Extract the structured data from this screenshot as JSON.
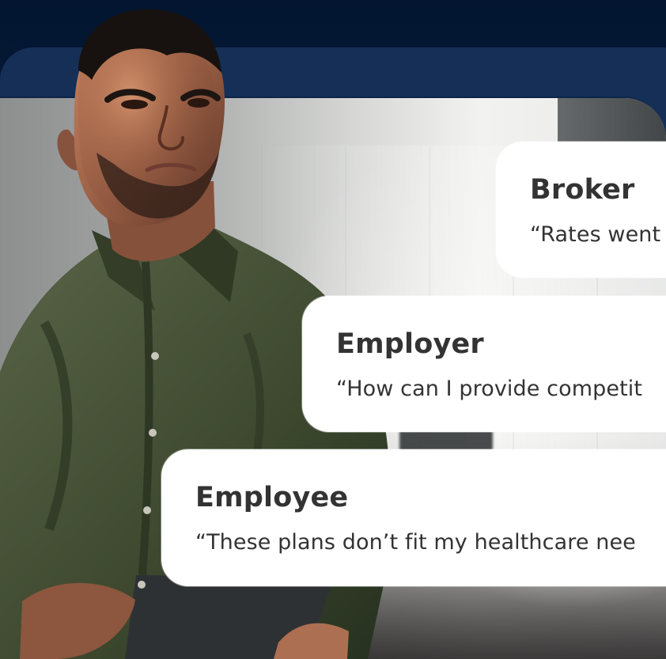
{
  "image": {
    "alt": "A man in a dark olive shirt looking away beside testimonial cards"
  },
  "quotes": [
    {
      "title": "Broker",
      "text": "“Rates went"
    },
    {
      "title": "Employer",
      "text": "“How can I provide competit"
    },
    {
      "title": "Employee",
      "text": "“These plans don’t fit my healthcare nee"
    }
  ],
  "colors": {
    "background_navy": "#061a35",
    "frame_navy": "#152f56",
    "card_white": "#ffffff",
    "text_dark": "#333333",
    "shirt_olive": "#4b5538",
    "skin_tone": "#9b6548"
  },
  "icons": {
    "shirt_buttons": "button-dot-icon"
  }
}
